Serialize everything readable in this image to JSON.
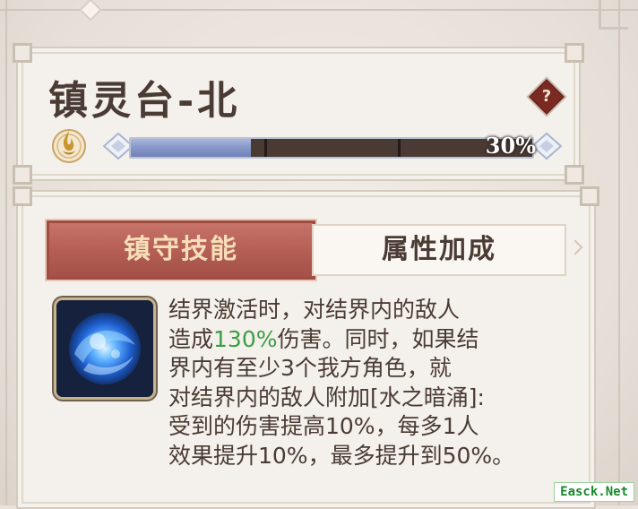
{
  "header": {
    "title": "镇灵台-北",
    "help_label": "?"
  },
  "progress": {
    "value": 0.3,
    "percent_label": "30%",
    "segments": 3,
    "fill_color": "#8596c8",
    "icon": "flame-swirl-icon"
  },
  "tabs": [
    {
      "label": "镇守技能",
      "active": true
    },
    {
      "label": "属性加成",
      "active": false
    }
  ],
  "skill": {
    "icon": "water-orb-icon",
    "description_lines": [
      [
        "结界激活时，对结界内的敌人"
      ],
      [
        "造成",
        "130%",
        "伤害。同时，如果结"
      ],
      [
        "界内有至少3个我方角色，就"
      ],
      [
        "对结界内的敌人附加[水之暗涌]:"
      ],
      [
        "受到的伤害提高10%，每多1人"
      ],
      [
        "效果提升10%，最多提升到50%。"
      ]
    ],
    "highlight_color": "#3c9e45"
  },
  "watermark": "Easck.Net",
  "colors": {
    "accent_red": "#b35d53",
    "text_brown": "#4a3b34",
    "tab_text_gold": "#f5deb8"
  }
}
